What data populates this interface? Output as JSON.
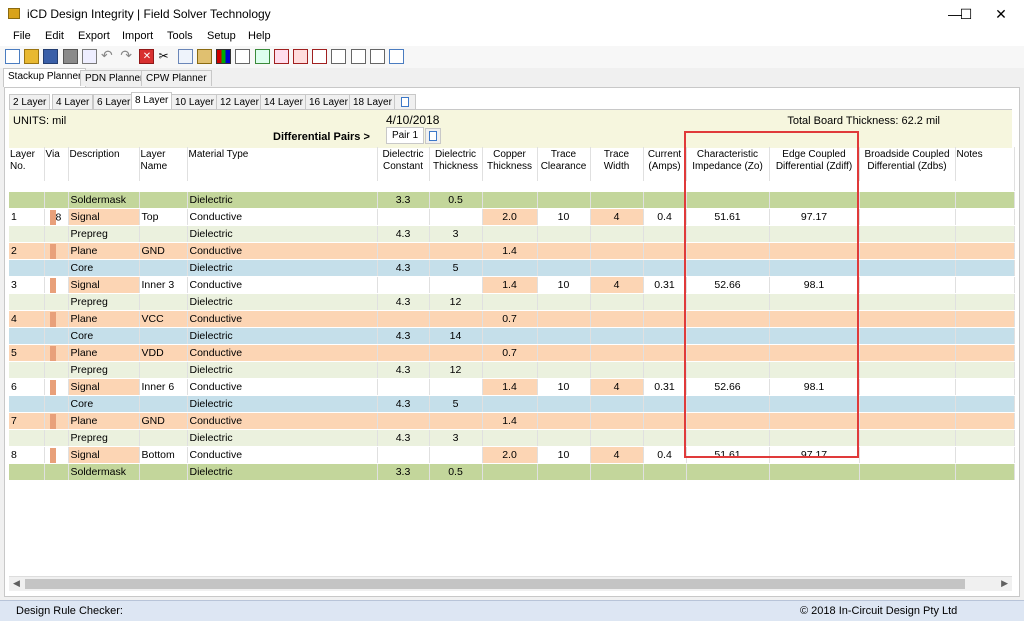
{
  "window": {
    "title": "iCD Design Integrity | Field Solver Technology",
    "minimize": "—",
    "maximize": "☐",
    "close": "✕"
  },
  "menu": [
    "File",
    "Edit",
    "Export",
    "Import",
    "Tools",
    "Setup",
    "Help"
  ],
  "toolbar_icons": [
    "new-file-icon",
    "open-folder-icon",
    "save-icon",
    "print-icon",
    "print-preview-icon",
    "undo-icon",
    "redo-icon",
    "delete-icon",
    "cut-icon",
    "copy-icon",
    "paste-icon",
    "stackup-icon",
    "chart-icon",
    "export-icon",
    "impedance-icon",
    "via-icon",
    "bars-icon",
    "graph-icon",
    "curve-icon",
    "wave-icon",
    "calendar-icon"
  ],
  "main_tabs": [
    "Stackup Planner",
    "PDN Planner",
    "CPW Planner"
  ],
  "layer_tabs": [
    "2 Layer",
    "4 Layer",
    "6 Layer",
    "8 Layer",
    "10 Layer",
    "12 Layer",
    "14 Layer",
    "16 Layer",
    "18 Layer"
  ],
  "info": {
    "units": "UNITS: mil",
    "date": "4/10/2018",
    "total": "Total Board Thickness: 62.2 mil",
    "diff_pairs_label": "Differential Pairs >",
    "pair_tab": "Pair 1"
  },
  "columns": [
    "Layer No.",
    "Via",
    "Description",
    "Layer Name",
    "Material Type",
    "Dielectric Constant",
    "Dielectric Thickness",
    "Copper Thickness",
    "Trace Clearance",
    "Trace Width",
    "Current (Amps)",
    "Characteristic Impedance (Zo)",
    "Edge Coupled Differential (Zdiff)",
    "Broadside Coupled Differential (Zdbs)",
    "Notes"
  ],
  "rows": [
    {
      "type": "sm",
      "no": "",
      "via": "",
      "desc": "Soldermask",
      "name": "",
      "mat": "Dielectric",
      "dk": "3.3",
      "dt": "0.5",
      "cu": "",
      "tc": "",
      "tw": "",
      "cur": "",
      "zo": "",
      "zdiff": "",
      "zdbs": "",
      "notes": ""
    },
    {
      "type": "sig",
      "no": "1",
      "via": "8",
      "desc": "Signal",
      "name": "Top",
      "mat": "Conductive",
      "dk": "",
      "dt": "",
      "cu": "2.0",
      "tc": "10",
      "tw": "4",
      "cur": "0.4",
      "zo": "51.61",
      "zdiff": "97.17",
      "zdbs": "",
      "notes": ""
    },
    {
      "type": "pp",
      "no": "",
      "via": "",
      "desc": "Prepreg",
      "name": "",
      "mat": "Dielectric",
      "dk": "4.3",
      "dt": "3",
      "cu": "",
      "tc": "",
      "tw": "",
      "cur": "",
      "zo": "",
      "zdiff": "",
      "zdbs": "",
      "notes": ""
    },
    {
      "type": "plane",
      "no": "2",
      "via": "",
      "desc": "Plane",
      "name": "GND",
      "mat": "Conductive",
      "dk": "",
      "dt": "",
      "cu": "1.4",
      "tc": "",
      "tw": "",
      "cur": "",
      "zo": "",
      "zdiff": "",
      "zdbs": "",
      "notes": ""
    },
    {
      "type": "core",
      "no": "",
      "via": "",
      "desc": "Core",
      "name": "",
      "mat": "Dielectric",
      "dk": "4.3",
      "dt": "5",
      "cu": "",
      "tc": "",
      "tw": "",
      "cur": "",
      "zo": "",
      "zdiff": "",
      "zdbs": "",
      "notes": ""
    },
    {
      "type": "sig",
      "no": "3",
      "via": "",
      "desc": "Signal",
      "name": "Inner 3",
      "mat": "Conductive",
      "dk": "",
      "dt": "",
      "cu": "1.4",
      "tc": "10",
      "tw": "4",
      "cur": "0.31",
      "zo": "52.66",
      "zdiff": "98.1",
      "zdbs": "",
      "notes": ""
    },
    {
      "type": "pp",
      "no": "",
      "via": "",
      "desc": "Prepreg",
      "name": "",
      "mat": "Dielectric",
      "dk": "4.3",
      "dt": "12",
      "cu": "",
      "tc": "",
      "tw": "",
      "cur": "",
      "zo": "",
      "zdiff": "",
      "zdbs": "",
      "notes": ""
    },
    {
      "type": "plane",
      "no": "4",
      "via": "",
      "desc": "Plane",
      "name": "VCC",
      "mat": "Conductive",
      "dk": "",
      "dt": "",
      "cu": "0.7",
      "tc": "",
      "tw": "",
      "cur": "",
      "zo": "",
      "zdiff": "",
      "zdbs": "",
      "notes": ""
    },
    {
      "type": "core",
      "no": "",
      "via": "",
      "desc": "Core",
      "name": "",
      "mat": "Dielectric",
      "dk": "4.3",
      "dt": "14",
      "cu": "",
      "tc": "",
      "tw": "",
      "cur": "",
      "zo": "",
      "zdiff": "",
      "zdbs": "",
      "notes": ""
    },
    {
      "type": "plane",
      "no": "5",
      "via": "",
      "desc": "Plane",
      "name": "VDD",
      "mat": "Conductive",
      "dk": "",
      "dt": "",
      "cu": "0.7",
      "tc": "",
      "tw": "",
      "cur": "",
      "zo": "",
      "zdiff": "",
      "zdbs": "",
      "notes": ""
    },
    {
      "type": "pp",
      "no": "",
      "via": "",
      "desc": "Prepreg",
      "name": "",
      "mat": "Dielectric",
      "dk": "4.3",
      "dt": "12",
      "cu": "",
      "tc": "",
      "tw": "",
      "cur": "",
      "zo": "",
      "zdiff": "",
      "zdbs": "",
      "notes": ""
    },
    {
      "type": "sig",
      "no": "6",
      "via": "",
      "desc": "Signal",
      "name": "Inner 6",
      "mat": "Conductive",
      "dk": "",
      "dt": "",
      "cu": "1.4",
      "tc": "10",
      "tw": "4",
      "cur": "0.31",
      "zo": "52.66",
      "zdiff": "98.1",
      "zdbs": "",
      "notes": ""
    },
    {
      "type": "core",
      "no": "",
      "via": "",
      "desc": "Core",
      "name": "",
      "mat": "Dielectric",
      "dk": "4.3",
      "dt": "5",
      "cu": "",
      "tc": "",
      "tw": "",
      "cur": "",
      "zo": "",
      "zdiff": "",
      "zdbs": "",
      "notes": ""
    },
    {
      "type": "plane",
      "no": "7",
      "via": "",
      "desc": "Plane",
      "name": "GND",
      "mat": "Conductive",
      "dk": "",
      "dt": "",
      "cu": "1.4",
      "tc": "",
      "tw": "",
      "cur": "",
      "zo": "",
      "zdiff": "",
      "zdbs": "",
      "notes": ""
    },
    {
      "type": "pp",
      "no": "",
      "via": "",
      "desc": "Prepreg",
      "name": "",
      "mat": "Dielectric",
      "dk": "4.3",
      "dt": "3",
      "cu": "",
      "tc": "",
      "tw": "",
      "cur": "",
      "zo": "",
      "zdiff": "",
      "zdbs": "",
      "notes": ""
    },
    {
      "type": "sig",
      "no": "8",
      "via": "",
      "desc": "Signal",
      "name": "Bottom",
      "mat": "Conductive",
      "dk": "",
      "dt": "",
      "cu": "2.0",
      "tc": "10",
      "tw": "4",
      "cur": "0.4",
      "zo": "51.61",
      "zdiff": "97.17",
      "zdbs": "",
      "notes": ""
    },
    {
      "type": "sm",
      "no": "",
      "via": "",
      "desc": "Soldermask",
      "name": "",
      "mat": "Dielectric",
      "dk": "3.3",
      "dt": "0.5",
      "cu": "",
      "tc": "",
      "tw": "",
      "cur": "",
      "zo": "",
      "zdiff": "",
      "zdbs": "",
      "notes": ""
    }
  ],
  "status": {
    "left": "Design Rule Checker:",
    "right": "© 2018 In-Circuit Design Pty Ltd"
  },
  "colors": {
    "soldermask": "#c3d69b",
    "prepreg": "#ebf1de",
    "core": "#c5dfea",
    "plane": "#fcd5b4",
    "highlight_box": "#e03a3a"
  }
}
